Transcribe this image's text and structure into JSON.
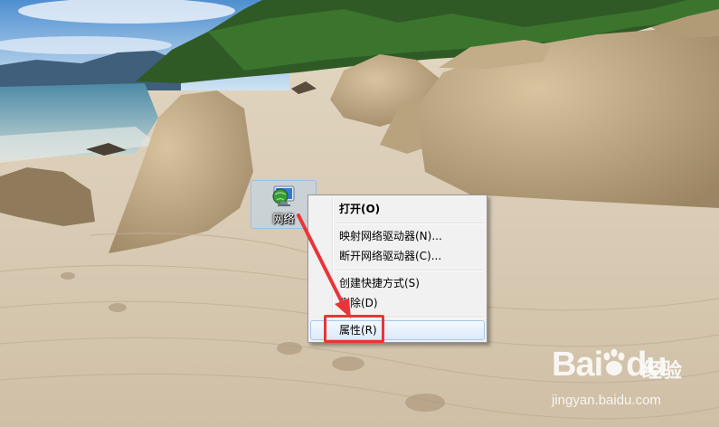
{
  "desktop": {
    "icon": {
      "name": "网络",
      "icon": "network-globe-icon"
    }
  },
  "context_menu": {
    "items": [
      {
        "label": "打开(O)",
        "bold": true
      },
      {
        "label": "映射网络驱动器(N)..."
      },
      {
        "label": "断开网络驱动器(C)..."
      },
      {
        "label": "创建快捷方式(S)"
      },
      {
        "label": "删除(D)"
      },
      {
        "label": "属性(R)",
        "highlighted": true
      }
    ]
  },
  "annotation": {
    "color": "#e8353a"
  },
  "watermark": {
    "logo": "Bai",
    "logo_tail": "du",
    "cn": "经验",
    "url": "jingyan.baidu.com"
  }
}
